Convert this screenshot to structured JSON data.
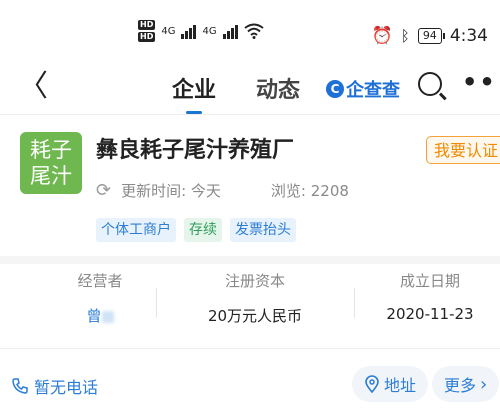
{
  "status_bar": {
    "hd1": "HD",
    "hd2": "HD",
    "net1": "4G",
    "net2": "4G",
    "battery": "94",
    "time": "4:34"
  },
  "nav": {
    "tab_company": "企业",
    "tab_news": "动态",
    "brand": "企查查"
  },
  "company": {
    "logo_line1": "耗子",
    "logo_line2": "尾汁",
    "name": "彝良耗子尾汁养殖厂",
    "cert_button": "我要认证",
    "updated_label": "更新时间: 今天",
    "views_label": "浏览: 2208",
    "tags": [
      "个体工商户",
      "存续",
      "发票抬头"
    ]
  },
  "stats": {
    "operator_label": "经营者",
    "operator_value": "曾",
    "capital_label": "注册资本",
    "capital_value": "20万元人民币",
    "founded_label": "成立日期",
    "founded_value": "2020-11-23"
  },
  "bottom_bar": {
    "phone": "暂无电话",
    "address": "地址",
    "more": "更多"
  },
  "colors": {
    "accent": "#1976d2",
    "logo_bg": "#6fb84f",
    "cert_border": "#f1a33a"
  }
}
